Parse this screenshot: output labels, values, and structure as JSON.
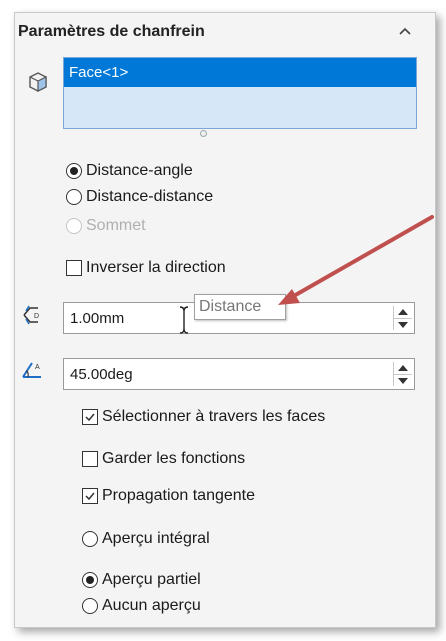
{
  "panel": {
    "title": "Paramètres de chanfrein",
    "selection": {
      "items": [
        "Face<1>"
      ]
    },
    "chamfer_type": {
      "options": [
        {
          "label": "Distance-angle",
          "selected": true,
          "enabled": true
        },
        {
          "label": "Distance-distance",
          "selected": false,
          "enabled": true
        },
        {
          "label": "Sommet",
          "selected": false,
          "enabled": false
        }
      ]
    },
    "flip_direction": {
      "label": "Inverser la direction",
      "checked": false
    },
    "distance": {
      "value": "1.00mm",
      "tooltip": "Distance"
    },
    "angle": {
      "value": "45.00deg"
    },
    "select_through_faces": {
      "label": "Sélectionner à travers les faces",
      "checked": true
    },
    "keep_features": {
      "label": "Garder les fonctions",
      "checked": false
    },
    "tangent_propagation": {
      "label": "Propagation tangente",
      "checked": true
    },
    "preview": {
      "full": {
        "label": "Aperçu intégral",
        "selected": false
      },
      "partial": {
        "label": "Aperçu partiel",
        "selected": true
      },
      "none": {
        "label": "Aucun aperçu",
        "selected": false
      }
    }
  },
  "colors": {
    "selection_highlight": "#0078d7",
    "selection_box": "#d6e8f7",
    "annotation_arrow": "#c0504d",
    "icon_blue": "#1f6fc5"
  }
}
